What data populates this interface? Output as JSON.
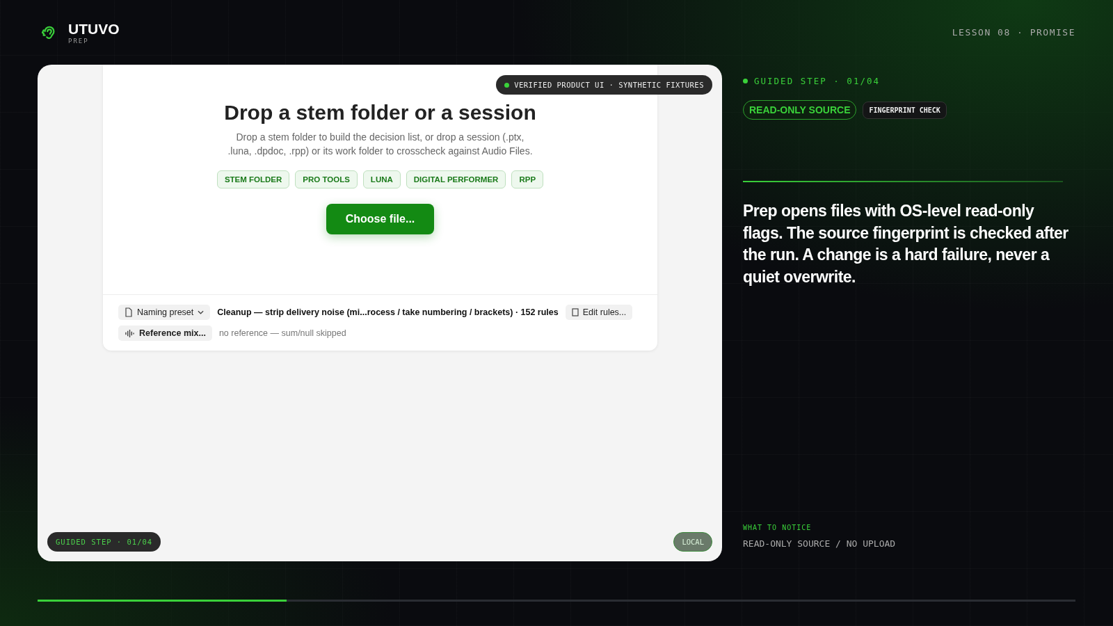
{
  "brand": {
    "name": "UTUVO",
    "sub": "PREP"
  },
  "lesson": "LESSON 08 · PROMISE",
  "stage": {
    "heading": "Drop a stem folder or a session",
    "description": "Drop a stem folder to build the decision list, or drop a session (.ptx, .luna, .dpdoc, .rpp) or its work folder to crosscheck against Audio Files.",
    "formats": [
      "STEM FOLDER",
      "PRO TOOLS",
      "LUNA",
      "DIGITAL PERFORMER",
      "RPP"
    ],
    "choose_button": "Choose file...",
    "naming_preset": {
      "label": "Naming preset",
      "value": "Cleanup — strip delivery noise (mi...rocess / take numbering / brackets) · 152 rules",
      "edit": "Edit rules..."
    },
    "reference": {
      "label": "Reference mix...",
      "value": "no reference — sum/null skipped"
    },
    "verified_badge": "VERIFIED PRODUCT UI · SYNTHETIC FIXTURES",
    "step_badge": "GUIDED STEP · 01/04",
    "local_badge": "LOCAL"
  },
  "side": {
    "step": "GUIDED STEP · 01/04",
    "tags": [
      {
        "label": "READ-ONLY SOURCE",
        "kind": "primary"
      },
      {
        "label": "FINGERPRINT CHECK",
        "kind": "secondary"
      }
    ],
    "statement": "Prep opens files with OS-level read-only flags. The source fingerprint is checked after the run. A change is a hard failure, never a quiet overwrite.",
    "notice_label": "WHAT TO NOTICE",
    "notice": "READ-ONLY SOURCE / NO UPLOAD"
  },
  "progress": {
    "level": 0.24
  }
}
